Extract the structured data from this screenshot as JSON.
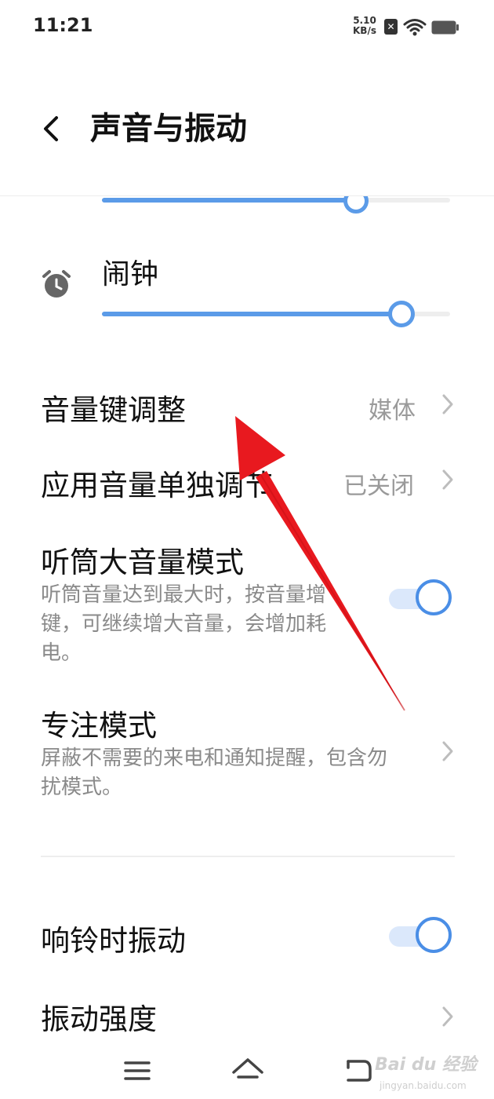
{
  "status_bar": {
    "time": "11:21",
    "net_speed_value": "5.10",
    "net_speed_unit": "KB/s",
    "sim_icon": "sim-disabled-icon",
    "wifi_icon": "wifi-icon",
    "battery_icon": "battery-icon"
  },
  "header": {
    "back_icon": "chevron-left-icon",
    "title": "声音与振动"
  },
  "previous_slider": {
    "level": 0.73
  },
  "alarm": {
    "label": "闹钟",
    "icon": "alarm-clock-icon",
    "level": 0.86
  },
  "settings": {
    "volume_keys": {
      "title": "音量键调整",
      "value": "媒体"
    },
    "app_volume": {
      "title": "应用音量单独调节",
      "value": "已关闭"
    },
    "receiver_loud": {
      "title": "听筒大音量模式",
      "description": "听筒音量达到最大时，按音量增键，可继续增大音量，会增加耗电。",
      "enabled": true
    },
    "focus_mode": {
      "title": "专注模式",
      "description": "屏蔽不需要的来电和通知提醒，包含勿扰模式。"
    },
    "vibrate_on_ring": {
      "title": "响铃时振动",
      "enabled": true
    },
    "vibration_strength": {
      "title": "振动强度"
    }
  },
  "nav_bar": {
    "menu_icon": "menu-icon",
    "home_icon": "home-icon",
    "back_icon": "back-arrow-icon"
  },
  "watermark": {
    "text": "Bai du 经验",
    "url": "jingyan.baidu.com"
  },
  "colors": {
    "accent": "#4a8ee6",
    "annotation_arrow": "#e8191f",
    "secondary_text": "#9a9a9a"
  }
}
